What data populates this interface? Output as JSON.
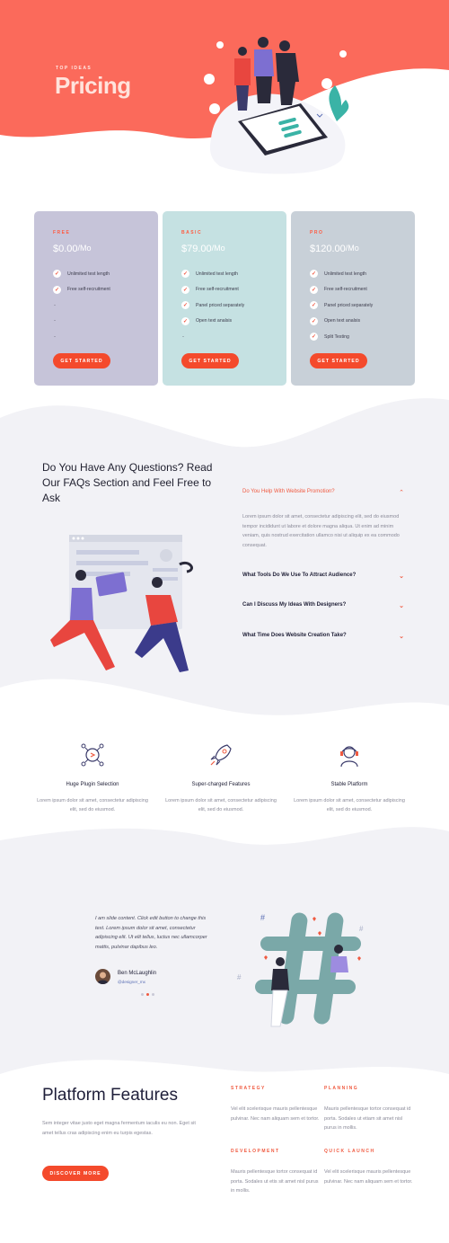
{
  "hero": {
    "eyebrow": "TOP IDEAS",
    "title": "Pricing",
    "colors": {
      "background": "#fb6a5b",
      "accent": "#f44a2c"
    }
  },
  "pricing": {
    "button_label": "GET STARTED",
    "plans": [
      {
        "tier": "FREE",
        "price": "$0.00",
        "period": "/Mo",
        "bg": "#c6c4d9",
        "features": [
          "Unlimited test length",
          "Free self-recruitment",
          "-",
          "-",
          "-"
        ]
      },
      {
        "tier": "BASIC",
        "price": "$79.00",
        "period": "/Mo",
        "bg": "#c5e1e2",
        "features": [
          "Unlimited test length",
          "Free self-recruitment",
          "Panel priced separately",
          "Open text analsis",
          "-"
        ]
      },
      {
        "tier": "PRO",
        "price": "$120.00",
        "period": "/Mo",
        "bg": "#c8d0d8",
        "features": [
          "Unlimited test length",
          "Free self-recruitment",
          "Panel priced separately",
          "Open text analsis",
          "Split Testing"
        ]
      }
    ]
  },
  "faq": {
    "heading": "Do You Have Any Questions? Read Our FAQs Section and Feel Free to Ask",
    "items": [
      {
        "question": "Do You Help With Website Promotion?",
        "open": true,
        "answer": "Lorem ipsum dolor sit amet, consectetur adipiscing elit, sed do eiusmod tempor incididunt ut labore et dolore magna aliqua. Ut enim ad minim veniam, quis nostrud exercitation ullamco nisi ut aliquip ex ea commodo consequat."
      },
      {
        "question": "What Tools Do We Use To Attract Audience?",
        "open": false
      },
      {
        "question": "Can I Discuss My Ideas With Designers?",
        "open": false
      },
      {
        "question": "What Time Does Website Creation Take?",
        "open": false
      }
    ]
  },
  "features": [
    {
      "icon": "plugin-icon",
      "title": "Huge Plugin Selection",
      "desc": "Lorem ipsum dolor sit amet, consectetur adipiscing elit, sed do eiusmod."
    },
    {
      "icon": "rocket-icon",
      "title": "Super-charged Features",
      "desc": "Lorem ipsum dolor sit amet, consectetur adipiscing elit, sed do eiusmod."
    },
    {
      "icon": "headset-icon",
      "title": "Stable Platform",
      "desc": "Lorem ipsum dolor sit amet, consectetur adipiscing elit, sed do eiusmod."
    }
  ],
  "testimonial": {
    "quote": "I am slide content. Click edit button to change this text. Lorem ipsum dolor sit amet, consectetur adipiscing elit. Ut elit tellus, luctus nec ullamcorper mattis, pulvinar dapibus leo.",
    "name": "Ben McLaughlin",
    "handle": "@designer_mx"
  },
  "platform": {
    "title": "Platform Features",
    "desc": "Sem integer vitae justo eget magna fermentum iaculis eu non. Eget sit amet tellus cras adipiscing enim eu turpis egestas.",
    "button_label": "DISCOVER MORE",
    "items": [
      {
        "label": "STRATEGY",
        "text": "Vel elit scelerisque mauris pellentesque pulvinar. Nec nam aliquam sem et tortor."
      },
      {
        "label": "PLANNING",
        "text": "Mauris pellentesque tortor consequat id porta. Sodales ut etiam sit amet nisl purus in mollis."
      },
      {
        "label": "DEVELOPMENT",
        "text": "Mauris pellentesque tortor consequat id porta. Sodales ut etis sit amet nisl purus in mollis."
      },
      {
        "label": "QUICK LAUNCH",
        "text": "Vel elit scelerisque mauris pellentesque pulvinar. Nec nam aliquam sem et tortor."
      }
    ]
  }
}
